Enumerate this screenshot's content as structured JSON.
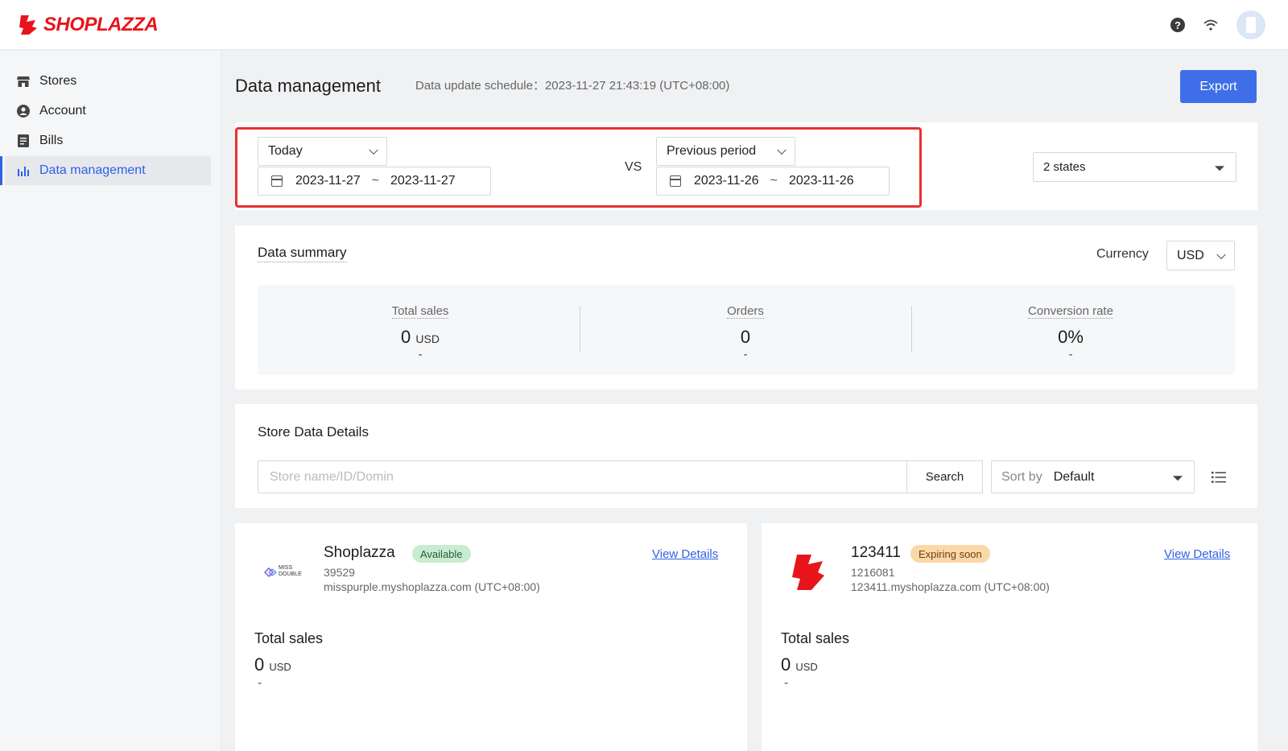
{
  "brand": {
    "name": "SHOPLAZZA",
    "color": "#e8141b"
  },
  "topbar": {
    "icons": [
      "help-icon",
      "wifi-icon",
      "avatar"
    ]
  },
  "sidebar": {
    "items": [
      {
        "label": "Stores",
        "icon": "store-icon"
      },
      {
        "label": "Account",
        "icon": "account-icon"
      },
      {
        "label": "Bills",
        "icon": "bill-icon"
      },
      {
        "label": "Data management",
        "icon": "bar-chart-icon",
        "active": true
      }
    ]
  },
  "header": {
    "title": "Data management",
    "update_schedule": "Data update schedule：2023-11-27 21:43:19 (UTC+08:00)",
    "export_label": "Export"
  },
  "filters": {
    "period": "Today",
    "start_date": "2023-11-27",
    "end_date": "2023-11-27",
    "range_separator": "~",
    "vs_label": "VS",
    "compare_period": "Previous period",
    "compare_start": "2023-11-26",
    "compare_end": "2023-11-26",
    "states": "2 states"
  },
  "summary": {
    "title": "Data summary",
    "currency_label": "Currency",
    "currency": "USD",
    "metrics": [
      {
        "label": "Total sales",
        "value": "0",
        "unit": "USD",
        "change": "-"
      },
      {
        "label": "Orders",
        "value": "0",
        "unit": "",
        "change": "-"
      },
      {
        "label": "Conversion rate",
        "value": "0%",
        "unit": "",
        "change": "-"
      }
    ]
  },
  "details": {
    "title": "Store Data Details",
    "search_placeholder": "Store name/ID/Domin",
    "search_label": "Search",
    "sort_label": "Sort by",
    "sort_value": "Default"
  },
  "stores": [
    {
      "name": "Shoplazza",
      "status": "Available",
      "id": "39529",
      "domain": "misspurple.myshoplazza.com (UTC+08:00)",
      "logo_text": "MISS DOUBLE",
      "view_label": "View Details",
      "sales_label": "Total sales",
      "sales_value": "0",
      "sales_unit": "USD",
      "sales_change": "-"
    },
    {
      "name": "123411",
      "status": "Expiring soon",
      "id": "1216081",
      "domain": "123411.myshoplazza.com (UTC+08:00)",
      "view_label": "View Details",
      "sales_label": "Total sales",
      "sales_value": "0",
      "sales_unit": "USD",
      "sales_change": "-"
    }
  ],
  "colors": {
    "accent": "#3e6fe8",
    "highlight": "#e8302f",
    "arrow": "#e8302f"
  }
}
